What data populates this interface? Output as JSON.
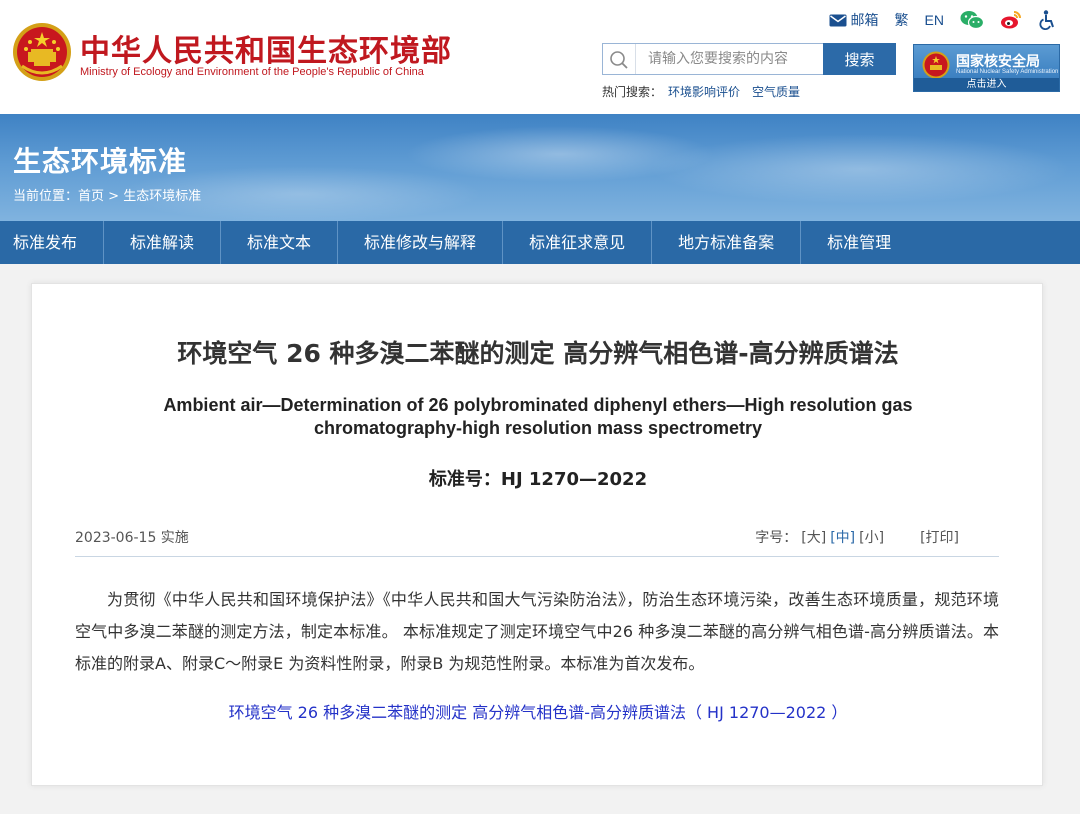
{
  "header": {
    "site_title": "中华人民共和国生态环境部",
    "site_subtitle": "Ministry of Ecology and Environment of the People's Republic of China",
    "tools": {
      "mail_label": "邮箱",
      "traditional_label": "繁",
      "english_label": "EN",
      "icons": [
        "mail-icon",
        "wechat-icon",
        "weibo-icon",
        "accessibility-icon"
      ]
    },
    "search": {
      "placeholder": "请输入您要搜索的内容",
      "button_label": "搜索",
      "hot_label": "热门搜索：",
      "hot_items": [
        "环境影响评价",
        "空气质量"
      ]
    },
    "nnsa": {
      "name": "国家核安全局",
      "name_en": "National Nuclear Safety Administration",
      "enter_label": "点击进入"
    },
    "colors": {
      "brand_red": "#c0181f",
      "nav_blue": "#2a69a6"
    }
  },
  "banner": {
    "title": "生态环境标准",
    "breadcrumb_prefix": "当前位置：",
    "breadcrumb_home": "首页",
    "breadcrumb_sep": " > ",
    "breadcrumb_current": "生态环境标准"
  },
  "nav": {
    "items": [
      "标准发布",
      "标准解读",
      "标准文本",
      "标准修改与解释",
      "标准征求意见",
      "地方标准备案",
      "标准管理"
    ]
  },
  "article": {
    "title": "环境空气 26 种多溴二苯醚的测定 高分辨气相色谱-高分辨质谱法",
    "title_en": "Ambient air—Determination of 26 polybrominated diphenyl ethers—High resolution gas chromatography-high resolution mass spectrometry",
    "standard_no": "标准号：HJ 1270—2022",
    "date": "2023-06-15 实施",
    "font_size_label": "字号：",
    "font_large": "[大]",
    "font_medium": "[中]",
    "font_small": "[小]",
    "print_label": "[打印]",
    "body": "为贯彻《中华人民共和国环境保护法》《中华人民共和国大气污染防治法》，防治生态环境污染，改善生态环境质量，规范环境空气中多溴二苯醚的测定方法，制定本标准。 本标准规定了测定环境空气中26 种多溴二苯醚的高分辨气相色谱-高分辨质谱法。本标准的附录A、附录C～附录E 为资料性附录，附录B 为规范性附录。本标准为首次发布。",
    "attachment_link": "环境空气 26 种多溴二苯醚的测定 高分辨气相色谱-高分辨质谱法（ HJ 1270—2022 ）"
  }
}
